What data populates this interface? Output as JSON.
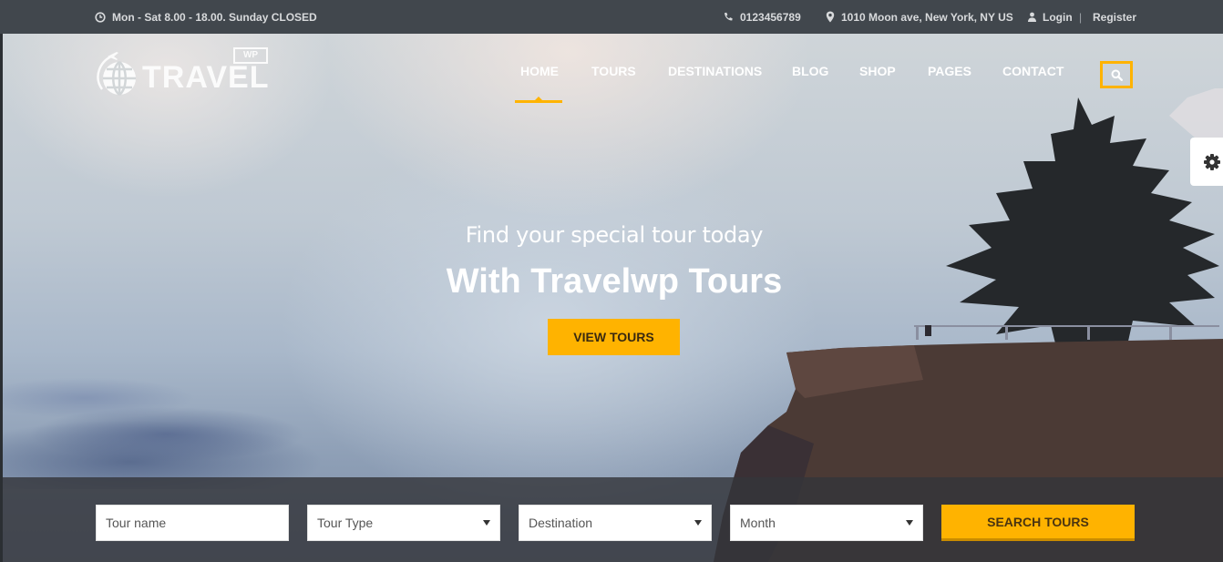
{
  "topbar": {
    "hours": "Mon - Sat 8.00 - 18.00. Sunday CLOSED",
    "phone": "0123456789",
    "address": "1010 Moon ave, New York, NY US",
    "login": "Login",
    "separator": "|",
    "register": "Register"
  },
  "logo": {
    "text": "TRAVEL",
    "badge": "WP"
  },
  "nav": {
    "items": [
      {
        "label": "HOME",
        "active": true
      },
      {
        "label": "TOURS"
      },
      {
        "label": "DESTINATIONS"
      },
      {
        "label": "BLOG"
      },
      {
        "label": "SHOP"
      },
      {
        "label": "PAGES"
      },
      {
        "label": "CONTACT"
      }
    ]
  },
  "hero": {
    "subtitle": "Find your special tour today",
    "title": "With Travelwp Tours",
    "button": "VIEW TOURS"
  },
  "search": {
    "tour_name_placeholder": "Tour name",
    "tour_type": "Tour Type",
    "destination": "Destination",
    "month": "Month",
    "button": "SEARCH TOURS"
  },
  "colors": {
    "accent": "#ffb300",
    "topbar_bg": "#41474d",
    "text_light": "#ffffff"
  },
  "icons": {
    "hours": "clock-icon",
    "phone": "phone-icon",
    "address": "map-marker-icon",
    "login": "user-icon",
    "search": "search-icon",
    "settings": "gear-icon",
    "logo": "globe-plane-icon"
  }
}
